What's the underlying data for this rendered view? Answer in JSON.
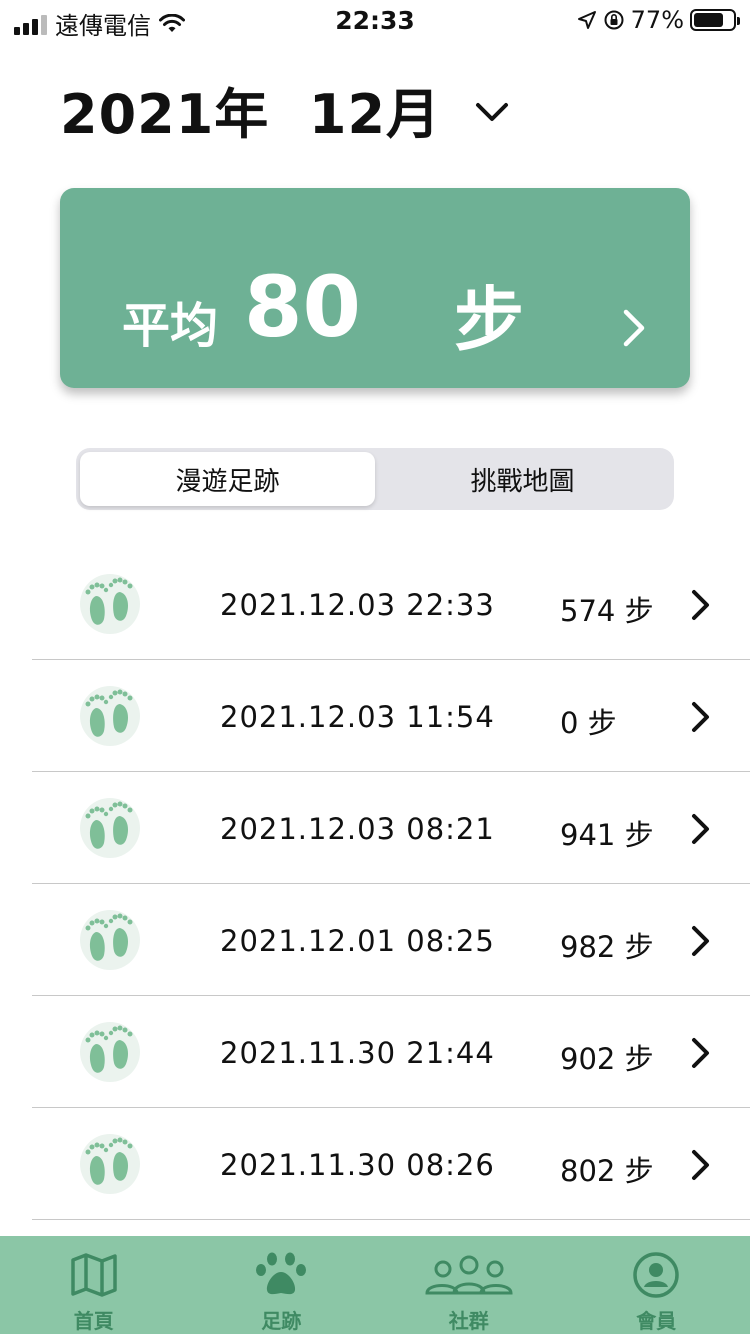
{
  "status_bar": {
    "carrier": "遠傳電信",
    "time": "22:33",
    "battery": "77%",
    "battery_level": 0.77
  },
  "header": {
    "month_title": "2021年  12月"
  },
  "average_card": {
    "label": "平均",
    "value": "80",
    "unit": "步"
  },
  "segments": [
    {
      "label": "漫遊足跡",
      "selected": true
    },
    {
      "label": "挑戰地圖",
      "selected": false
    }
  ],
  "records": [
    {
      "datetime": "2021.12.03 22:33",
      "steps": "574 步"
    },
    {
      "datetime": "2021.12.03 11:54",
      "steps": "0 步"
    },
    {
      "datetime": "2021.12.03 08:21",
      "steps": "941 步"
    },
    {
      "datetime": "2021.12.01 08:25",
      "steps": "982 步"
    },
    {
      "datetime": "2021.11.30 21:44",
      "steps": "902 步"
    },
    {
      "datetime": "2021.11.30 08:26",
      "steps": "802 步"
    }
  ],
  "tabs": [
    {
      "label": "首頁",
      "icon": "map-icon"
    },
    {
      "label": "足跡",
      "icon": "paw-icon"
    },
    {
      "label": "社群",
      "icon": "people-icon"
    },
    {
      "label": "會員",
      "icon": "user-icon"
    }
  ],
  "colors": {
    "card_green": "#6eb195",
    "tabbar_green": "#8bc6a6",
    "tab_icon_green": "#3f8a63",
    "footprint_green": "#7fbf98"
  }
}
